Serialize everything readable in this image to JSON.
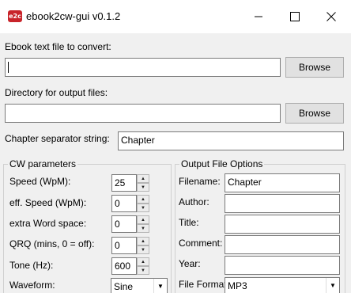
{
  "window": {
    "app_icon_text": "e2c",
    "title": "ebook2cw-gui v0.1.2"
  },
  "input_file": {
    "label": "Ebook text file to convert:",
    "value": "",
    "browse_label": "Browse"
  },
  "output_dir": {
    "label": "Directory for output files:",
    "value": "",
    "browse_label": "Browse"
  },
  "chapter": {
    "label": "Chapter separator string:",
    "value": "Chapter"
  },
  "cw_params": {
    "title": "CW parameters",
    "speed": {
      "label": "Speed (WpM):",
      "value": "25"
    },
    "eff_speed": {
      "label": "eff. Speed (WpM):",
      "value": "0"
    },
    "extra_space": {
      "label": "extra Word space:",
      "value": "0"
    },
    "qrq": {
      "label": "QRQ (mins, 0 = off):",
      "value": "0"
    },
    "tone": {
      "label": "Tone (Hz):",
      "value": "600"
    },
    "waveform": {
      "label": "Waveform:",
      "value": "Sine"
    }
  },
  "output_opts": {
    "title": "Output File Options",
    "filename": {
      "label": "Filename:",
      "value": "Chapter"
    },
    "author": {
      "label": "Author:",
      "value": ""
    },
    "title_field": {
      "label": "Title:",
      "value": ""
    },
    "comment": {
      "label": "Comment:",
      "value": ""
    },
    "year": {
      "label": "Year:",
      "value": ""
    },
    "format": {
      "label": "File Format:",
      "value": "MP3"
    }
  }
}
